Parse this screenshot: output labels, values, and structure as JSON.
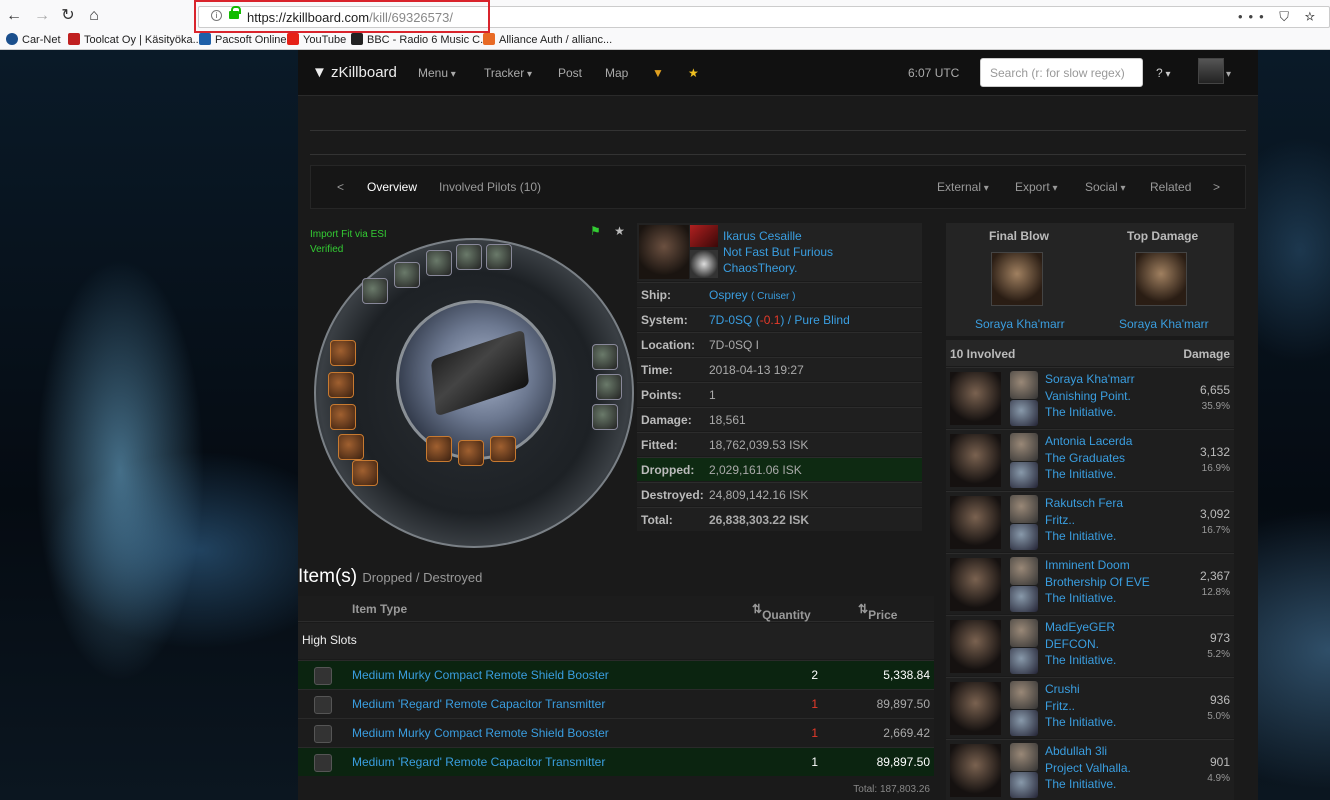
{
  "browser": {
    "url_host": "https://zkillboard.com",
    "url_path": "/kill/69326573/",
    "url_right": "••• ⛉ ☆",
    "bookmarks": [
      "Car-Net",
      "Toolcat Oy | Käsityökа...",
      "Pacsoft Online",
      "YouTube",
      "BBC - Radio 6 Music C...",
      "Alliance Auth / allianc..."
    ]
  },
  "nav": {
    "brand": "zKillboard",
    "menu": "Menu",
    "tracker": "Tracker",
    "post": "Post",
    "map": "Map",
    "time": "6:07 UTC",
    "search_placeholder": "Search (r: for slow regex)",
    "help": "?"
  },
  "subnav": {
    "prev": "<",
    "overview": "Overview",
    "involved": "Involved Pilots (10)",
    "external": "External",
    "export": "Export",
    "social": "Social",
    "related": "Related",
    "next": ">"
  },
  "fit": {
    "import": "Import Fit via ESI",
    "verified": "Verified"
  },
  "victim": {
    "name": "Ikarus Cesaille",
    "corp": "Not Fast But Furious",
    "alliance": "ChaosTheory.",
    "rows": [
      {
        "k": "Ship:",
        "v": "Osprey",
        "extra": "( Cruiser )"
      },
      {
        "k": "System:",
        "v": "7D-0SQ",
        "sec": "-0.1",
        "region": "Pure Blind"
      },
      {
        "k": "Location:",
        "v": "7D-0SQ I"
      },
      {
        "k": "Time:",
        "v": "2018-04-13 19:27"
      },
      {
        "k": "Points:",
        "v": "1"
      },
      {
        "k": "Damage:",
        "v": "18,561"
      },
      {
        "k": "Fitted:",
        "v": "18,762,039.53 ISK"
      },
      {
        "k": "Dropped:",
        "v": "2,029,161.06 ISK"
      },
      {
        "k": "Destroyed:",
        "v": "24,809,142.16 ISK"
      },
      {
        "k": "Total:",
        "v": "26,838,303.22 ISK"
      }
    ]
  },
  "items": {
    "title": "Item(s)",
    "subtitle": "Dropped / Destroyed",
    "col_type": "Item Type",
    "col_qty": "Quantity",
    "col_price": "Price (ISK)",
    "section": "High Slots",
    "rows": [
      {
        "name": "Medium Murky Compact Remote Shield Booster",
        "qty": "2",
        "price": "5,338.84",
        "dropped": true
      },
      {
        "name": "Medium 'Regard' Remote Capacitor Transmitter",
        "qty": "1",
        "price": "89,897.50",
        "dropped": false
      },
      {
        "name": "Medium Murky Compact Remote Shield Booster",
        "qty": "1",
        "price": "2,669.42",
        "dropped": false
      },
      {
        "name": "Medium 'Regard' Remote Capacitor Transmitter",
        "qty": "1",
        "price": "89,897.50",
        "dropped": true
      }
    ],
    "total": "Total: 187,803.26"
  },
  "final_blow": {
    "fb_label": "Final Blow",
    "td_label": "Top Damage",
    "fb_name": "Soraya Kha'marr",
    "td_name": "Soraya Kha'marr"
  },
  "involved": {
    "header": "10 Involved",
    "damage_label": "Damage",
    "attackers": [
      {
        "name": "Soraya Kha'marr",
        "corp": "Vanishing Point.",
        "alliance": "The Initiative.",
        "dmg": "6,655",
        "pct": "35.9%"
      },
      {
        "name": "Antonia Lacerda",
        "corp": "The Graduates",
        "alliance": "The Initiative.",
        "dmg": "3,132",
        "pct": "16.9%"
      },
      {
        "name": "Rakutsch Fera",
        "corp": "Fritz..",
        "alliance": "The Initiative.",
        "dmg": "3,092",
        "pct": "16.7%"
      },
      {
        "name": "Imminent Doom",
        "corp": "Brothership Of EVE",
        "alliance": "The Initiative.",
        "dmg": "2,367",
        "pct": "12.8%"
      },
      {
        "name": "MadEyeGER",
        "corp": "DEFCON.",
        "alliance": "The Initiative.",
        "dmg": "973",
        "pct": "5.2%"
      },
      {
        "name": "Crushi",
        "corp": "Fritz..",
        "alliance": "The Initiative.",
        "dmg": "936",
        "pct": "5.0%"
      },
      {
        "name": "Abdullah 3li",
        "corp": "Project Valhalla.",
        "alliance": "The Initiative.",
        "dmg": "901",
        "pct": "4.9%"
      }
    ]
  }
}
